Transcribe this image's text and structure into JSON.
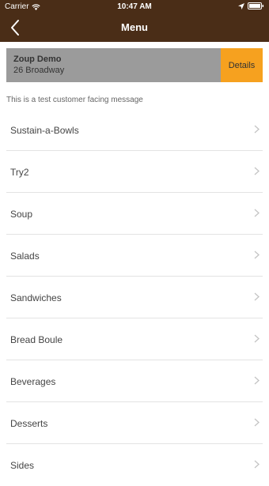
{
  "status_bar": {
    "carrier": "Carrier",
    "time": "10:47 AM"
  },
  "nav": {
    "title": "Menu"
  },
  "store": {
    "name": "Zoup Demo",
    "address": "26 Broadway",
    "details_label": "Details"
  },
  "message": "This is a test customer facing message",
  "menu": {
    "items": [
      {
        "label": "Sustain-a-Bowls"
      },
      {
        "label": "Try2"
      },
      {
        "label": "Soup"
      },
      {
        "label": "Salads"
      },
      {
        "label": "Sandwiches"
      },
      {
        "label": "Bread Boule"
      },
      {
        "label": "Beverages"
      },
      {
        "label": "Desserts"
      },
      {
        "label": "Sides"
      }
    ]
  },
  "colors": {
    "header_background": "#4a2d17",
    "store_card_background": "#9b9b9b",
    "details_button_background": "#f6a11f"
  },
  "icons": {
    "back": "back-arrow-icon",
    "chevron": "chevron-right-icon",
    "wifi": "wifi-icon",
    "location": "location-icon",
    "battery": "battery-icon"
  }
}
